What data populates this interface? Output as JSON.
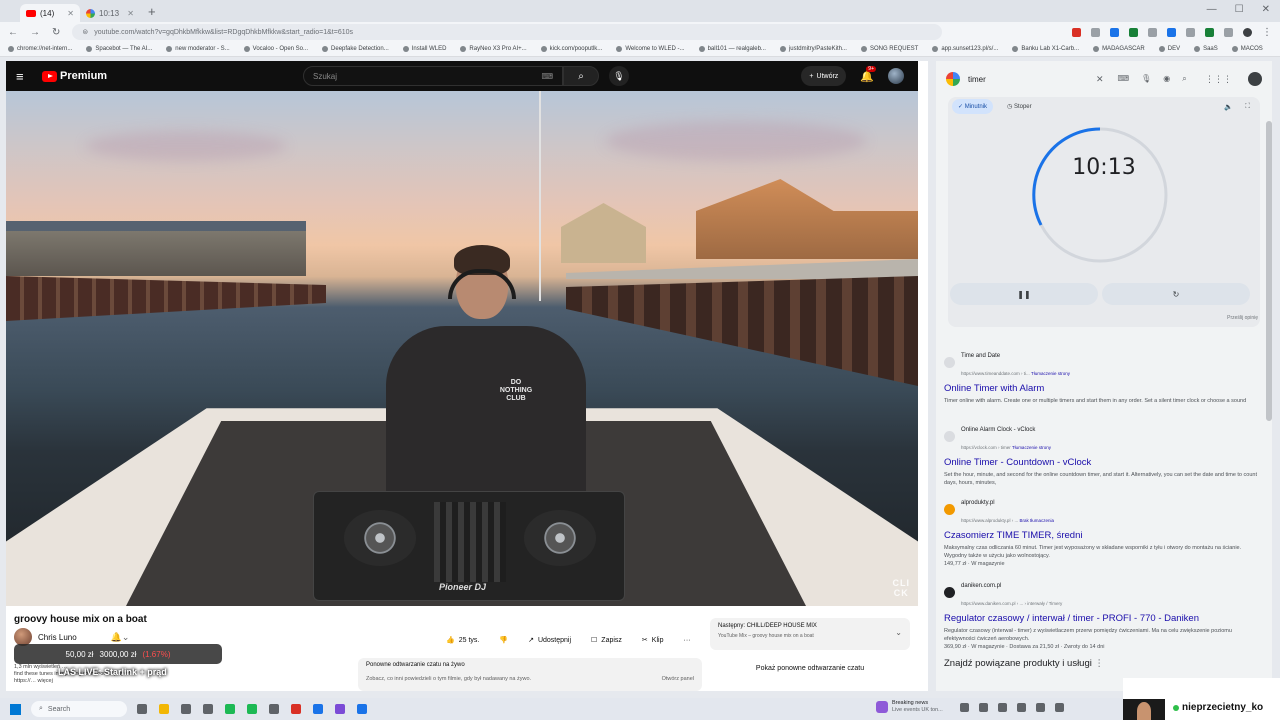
{
  "browser": {
    "tabs": [
      {
        "label": "(14)",
        "active": true
      },
      {
        "label": "10:13",
        "active": false
      }
    ],
    "address": "youtube.com/watch?v=gqDhkbMfkkw&list=RDgqDhkbMfkkw&start_radio=1&t=610s",
    "bookmarks": [
      "chrome://net-intern...",
      "Spacebot — The AI...",
      "new moderator - S...",
      "Vocaloo - Open So...",
      "Deepfake Detection...",
      "Install WLED",
      "RayNeo X3 Pro AI+...",
      "kick.com/pooputlk...",
      "Welcome to WLED -...",
      "ball101 — realgaleb...",
      "justdmitry/PasteKith...",
      "SONG REQUEST",
      "app.sunset123.pl/s/...",
      "Banku Lab X1-Carb...",
      "MADAGASCAR",
      "DEV",
      "SaaS",
      "MACOS"
    ]
  },
  "youtube": {
    "logo_text": "Premium",
    "search_placeholder": "Szukaj",
    "create_label": "Utwórz",
    "notif_count": "9+",
    "video": {
      "watermark": "CLI\nCK",
      "shirt_text": "DO\nNOTHING\nCLUB",
      "controller_brand": "Pioneer DJ"
    },
    "title": "groovy house mix on a boat",
    "channel": "Chris Luno",
    "actions": {
      "likes": "25 tys.",
      "share": "Udostępnij",
      "save": "Zapisz",
      "clip": "Klip",
      "more": "···"
    },
    "next": {
      "label": "Następny: CHILL/DEEP HOUSE MIX",
      "sub": "YouTube Mix – groovy house mix on a boat"
    },
    "description": "1,3 mln wyświetleń  …\nfind these tunes in my living room house player!\nhttps://…           więcej",
    "replay": {
      "title": "Ponowne odtwarzanie czatu na żywo",
      "text": "Zobacz, co inni powiedzieli o tym filmie, gdy był nadawany na żywo.",
      "open": "Otwórz panel",
      "show": "Pokaż ponowne odtwarzanie czatu"
    }
  },
  "stream_overlay": {
    "current": "50,00 zł",
    "goal": "3000,00 zł",
    "percent": "(1.67%)",
    "caption": "LAS LIVE: Starlink + prąd"
  },
  "google": {
    "query": "timer",
    "timer": {
      "tab_timer": "Minutnik",
      "tab_stopwatch": "Stoper",
      "time": "10:13",
      "pause_icon": "pause-icon",
      "reset_icon": "reset-icon",
      "feedback": "Prześlij opinię"
    },
    "results": [
      {
        "site": "Time and Date",
        "url": "https://www.timeanddate.com › ti...",
        "translate": "Tłumaczenie strony",
        "title": "Online Timer with Alarm",
        "snippet": "Timer online with alarm. Create one or multiple timers and start them in any order. Set a silent timer clock or choose a sound"
      },
      {
        "site": "Online Alarm Clock - vClock",
        "url": "https://vclock.com › timer",
        "translate": "Tłumaczenie strony",
        "title": "Online Timer - Countdown - vClock",
        "snippet": "Set the hour, minute, and second for the online countdown timer, and start it. Alternatively, you can set the date and time to count days, hours, minutes,"
      },
      {
        "site": "alprodukty.pl",
        "url": "https://www.alprodukty.pl › ...",
        "translate": "Brak tłumaczenia",
        "title": "Czasomierz TIME TIMER, średni",
        "snippet": "Maksymalny czas odliczania 60 minut. Timer jest wyposażony w składane wsporniki z tyłu i otwory do montażu na ścianie. Wygodny także w użyciu jako wolnostojący.\n149,77 zł · W magazynie"
      },
      {
        "site": "daniken.com.pl",
        "url": "https://www.daniken.com.pl › ... › interwały / Timery",
        "translate": "",
        "title": "Regulator czasowy / interwał / timer - PROFI - 770 - Daniken",
        "snippet": "Regulator czasowy (interwał - timer) z wyświetlaczem przerw pomiędzy ćwiczeniami. Ma na celu zwiększenie poziomu efektywności ćwiczeń aerobowych.\n369,90 zł · W magazynie · Dostawa za 21,50 zł · Zwroty do 14 dni"
      }
    ],
    "related": "Znajdź powiązane produkty i usługi"
  },
  "taskbar": {
    "search_placeholder": "Search",
    "news_title": "Breaking news",
    "news_sub": "Live events UK ton...",
    "streamer_name": "nieprzecietny_ko"
  }
}
